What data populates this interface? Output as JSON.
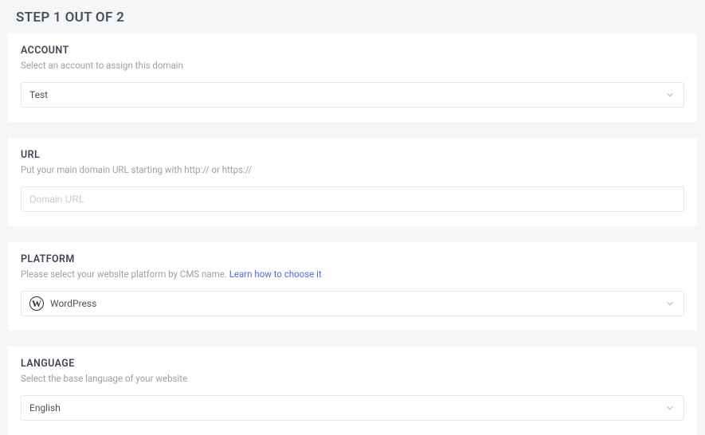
{
  "page": {
    "title": "STEP 1 OUT OF 2"
  },
  "account": {
    "label": "ACCOUNT",
    "hint": "Select an account to assign this domain",
    "value": "Test"
  },
  "url": {
    "label": "URL",
    "hint": "Put your main domain URL starting with http:// or https://",
    "placeholder": "Domain URL",
    "value": ""
  },
  "platform": {
    "label": "PLATFORM",
    "hint_prefix": "Please select your website platform by CMS name. ",
    "hint_link": "Learn how to choose it",
    "value": "WordPress",
    "icon": "wordpress-icon"
  },
  "language": {
    "label": "LANGUAGE",
    "hint": "Select the base language of your website",
    "value": "English"
  }
}
